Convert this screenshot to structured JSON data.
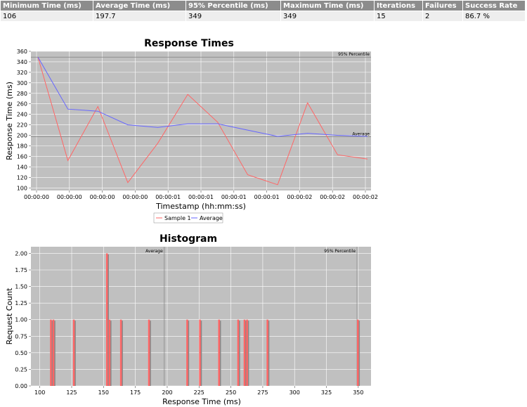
{
  "stats_table": {
    "headers": [
      "Minimum Time (ms)",
      "Average Time (ms)",
      "95% Percentile (ms)",
      "Maximum Time (ms)",
      "Iterations",
      "Failures",
      "Success Rate"
    ],
    "values": [
      "106",
      "197.7",
      "349",
      "349",
      "15",
      "2",
      "86.7 %"
    ]
  },
  "colors": {
    "plot_bg": "#c0c0c0",
    "grid": "#ffffff",
    "sample": "#ff6666",
    "average": "#6666ff",
    "bar": "#ff6666",
    "bar_shadow": "#888888",
    "marker": "#808080"
  },
  "chart_data": [
    {
      "type": "line",
      "title": "Response Times",
      "xlabel": "Timestamp (hh:mm:ss)",
      "ylabel": "Response Time (ms)",
      "ylim": [
        95,
        360
      ],
      "yticks": [
        100,
        120,
        140,
        160,
        180,
        200,
        220,
        240,
        260,
        280,
        300,
        320,
        340,
        360
      ],
      "xtick_labels": [
        "00:00:00",
        "00:00:00",
        "00:00:00",
        "00:00:00",
        "00:00:01",
        "00:00:01",
        "00:00:01",
        "00:00:01",
        "00:00:02",
        "00:00:02",
        "00:00:02"
      ],
      "legend": [
        "Sample 1",
        "Average"
      ],
      "legend_position": "bottom",
      "grid": true,
      "series": [
        {
          "name": "Sample 1",
          "values": [
            349,
            152,
            255,
            110,
            185,
            278,
            225,
            125,
            106,
            262,
            163,
            155
          ]
        },
        {
          "name": "Average",
          "values": [
            349,
            250,
            246,
            220,
            215,
            222,
            222,
            210,
            198,
            204,
            200,
            198
          ]
        }
      ],
      "markers": [
        {
          "label": "95% Percentile",
          "value": 349
        },
        {
          "label": "Average",
          "value": 197.7
        }
      ]
    },
    {
      "type": "bar",
      "title": "Histogram",
      "xlabel": "Response Time (ms)",
      "ylabel": "Request Count",
      "xlim": [
        93,
        360
      ],
      "ylim": [
        0,
        2.1
      ],
      "xticks": [
        100,
        125,
        150,
        175,
        200,
        225,
        250,
        275,
        300,
        325,
        350
      ],
      "yticks": [
        "0.00",
        "0.25",
        "0.50",
        "0.75",
        "1.00",
        "1.25",
        "1.50",
        "1.75",
        "2.00"
      ],
      "grid": true,
      "bars": [
        {
          "x": 108,
          "count": 1
        },
        {
          "x": 110,
          "count": 1
        },
        {
          "x": 126,
          "count": 1
        },
        {
          "x": 152,
          "count": 2
        },
        {
          "x": 154,
          "count": 1
        },
        {
          "x": 163,
          "count": 1
        },
        {
          "x": 185,
          "count": 1
        },
        {
          "x": 215,
          "count": 1
        },
        {
          "x": 225,
          "count": 1
        },
        {
          "x": 240,
          "count": 1
        },
        {
          "x": 255,
          "count": 1
        },
        {
          "x": 260,
          "count": 1
        },
        {
          "x": 262,
          "count": 1
        },
        {
          "x": 278,
          "count": 1
        },
        {
          "x": 349,
          "count": 1
        }
      ],
      "markers": [
        {
          "label": "Average",
          "value": 197.7
        },
        {
          "label": "95% Percentile",
          "value": 349
        }
      ]
    }
  ]
}
